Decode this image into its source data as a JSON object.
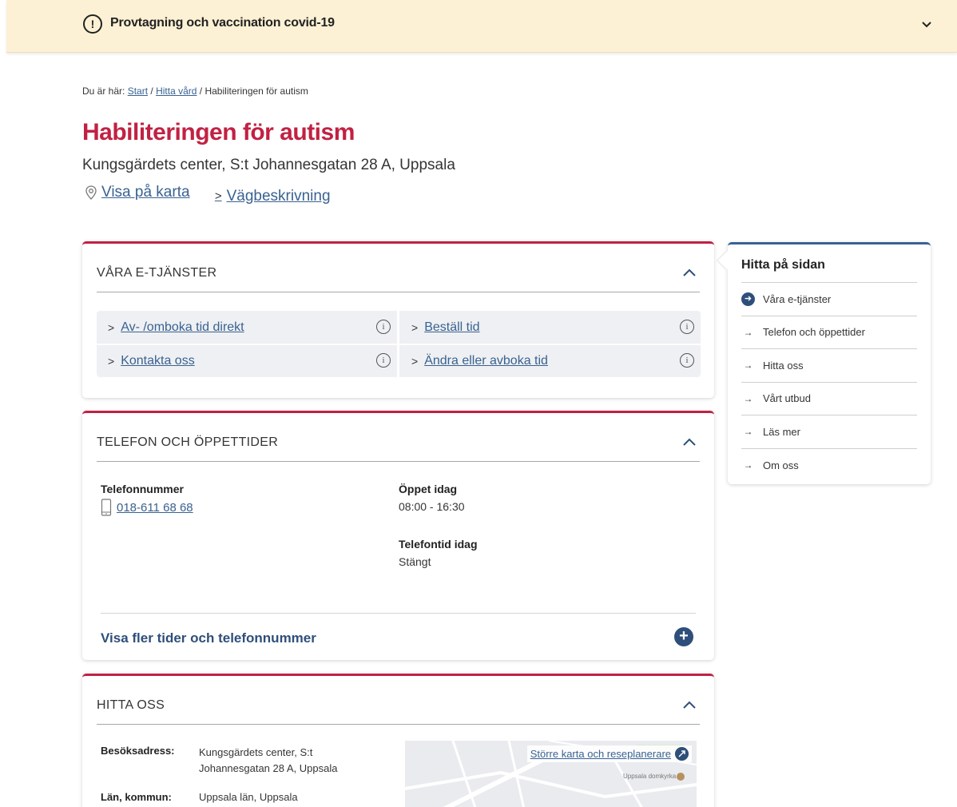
{
  "banner": {
    "alert_icon": "!",
    "text": "Provtagning och vaccination covid-19",
    "chevron_icon": "chevron-down-icon"
  },
  "breadcrumb": {
    "prefix": "Du är här:",
    "items": [
      "Start",
      "Hitta vård"
    ],
    "separator": "/",
    "current": "Habiliteringen för autism"
  },
  "page": {
    "title": "Habiliteringen för autism",
    "address": "Kungsgärdets center, S:t Johannesgatan 28 A, Uppsala",
    "show_on_map": "Visa på karta",
    "directions": "Vägbeskrivning"
  },
  "eservices": {
    "title": "VÅRA E-TJÄNSTER",
    "items": [
      "Av- /omboka tid direkt",
      "Beställ tid",
      "Kontakta oss",
      "Ändra eller avboka tid"
    ],
    "info_glyph": "i"
  },
  "phone": {
    "title": "TELEFON OCH ÖPPETTIDER",
    "phone_label": "Telefonnummer",
    "phone_number": "018-611 68 68",
    "open_label": "Öppet idag",
    "open_value": "08:00 - 16:30",
    "phonetime_label": "Telefontid idag",
    "phonetime_value": "Stängt",
    "more_label": "Visa fler tider och telefonnummer",
    "plus_glyph": "+"
  },
  "find_us": {
    "title": "HITTA OSS",
    "visit_label": "Besöksadress:",
    "visit_value_line1": "Kungsgärdets center, S:t",
    "visit_value_line2": "Johannesgatan 28 A, Uppsala",
    "region_label": "Län, kommun:",
    "region_value": "Uppsala län, Uppsala",
    "map_link": "Större karta och reseplanerare",
    "map_poi": "Uppsala domkyrka"
  },
  "sidenav": {
    "title": "Hitta på sidan",
    "items": [
      "Våra e-tjänster",
      "Telefon och öppettider",
      "Hitta oss",
      "Vårt utbud",
      "Läs mer",
      "Om oss"
    ],
    "active_index": 0
  }
}
